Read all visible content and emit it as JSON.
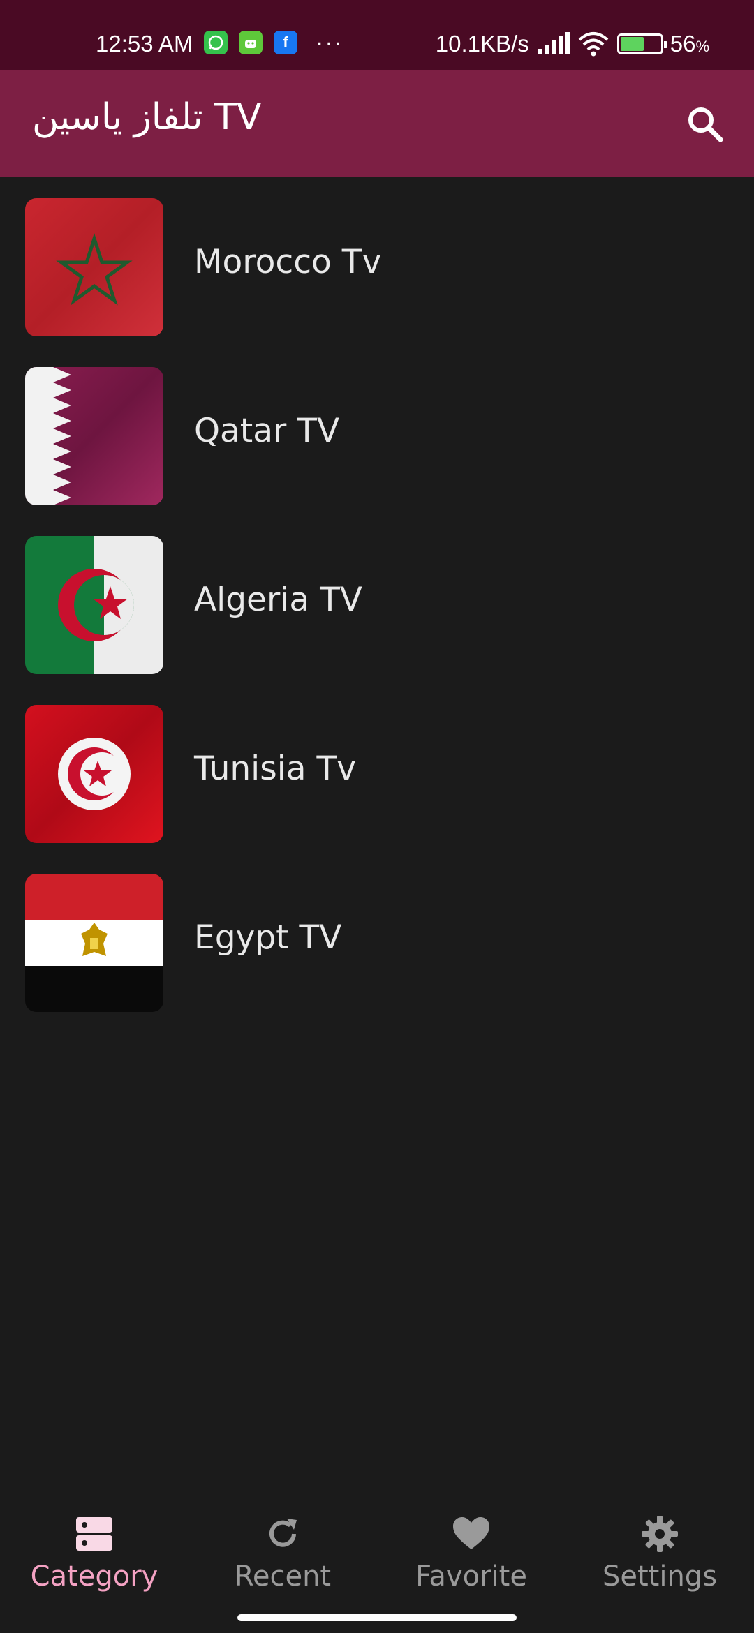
{
  "status_bar": {
    "time": "12:53 AM",
    "network_speed": "10.1KB/s",
    "battery": "56",
    "battery_unit": "%",
    "notification_icons": [
      "whatsapp-icon",
      "android-icon",
      "facebook-icon"
    ],
    "more": "···"
  },
  "app_bar": {
    "title": "تلفاز ياسين TV",
    "search_icon": "search-icon",
    "color": "#7d1f44"
  },
  "channels": [
    {
      "label": "Morocco Tv",
      "flag": "morocco"
    },
    {
      "label": "Qatar TV",
      "flag": "qatar"
    },
    {
      "label": "Algeria TV",
      "flag": "algeria"
    },
    {
      "label": "Tunisia Tv",
      "flag": "tunisia"
    },
    {
      "label": "Egypt TV",
      "flag": "egypt"
    }
  ],
  "bottom_nav": {
    "items": [
      {
        "label": "Category",
        "icon": "category-icon",
        "active": true
      },
      {
        "label": "Recent",
        "icon": "refresh-icon",
        "active": false
      },
      {
        "label": "Favorite",
        "icon": "heart-icon",
        "active": false
      },
      {
        "label": "Settings",
        "icon": "gear-icon",
        "active": false
      }
    ],
    "active_color": "#f4a2c3",
    "inactive_color": "#9a9a9a"
  }
}
